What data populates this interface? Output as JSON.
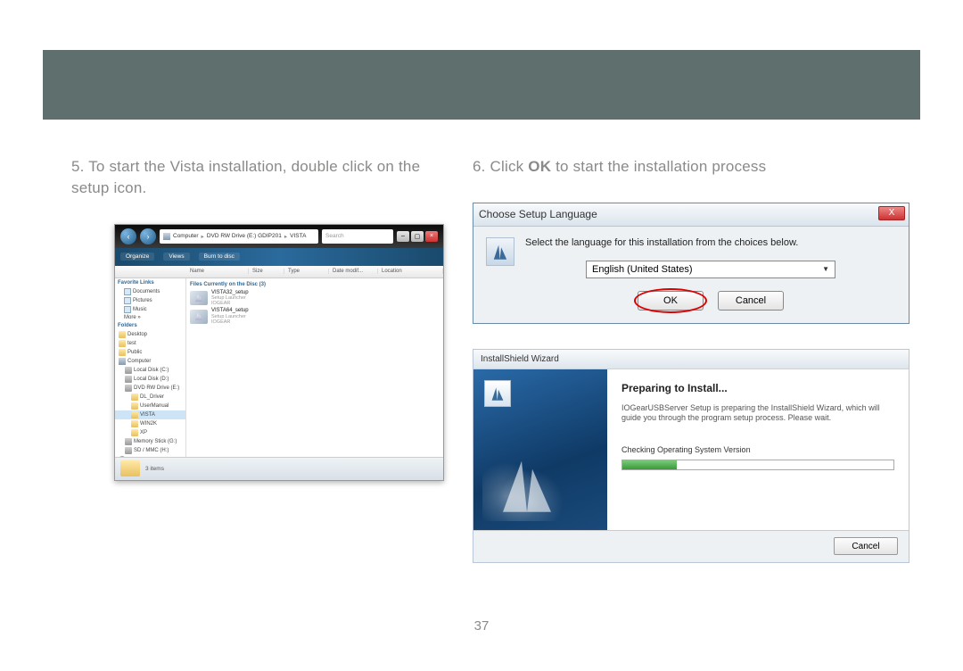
{
  "page_number": "37",
  "steps": {
    "s5_num": "5. ",
    "s5_text": "To start the Vista installation, double click on the setup icon.",
    "s6_num": "6. ",
    "s6_a": "Click ",
    "s6_ok": "OK",
    "s6_b": " to start the installation process"
  },
  "explorer": {
    "breadcrumb": [
      "Computer",
      "DVD RW Drive (E:) GDIP201",
      "VISTA"
    ],
    "search_placeholder": "Search",
    "toolbar": {
      "organize": "Organize",
      "views": "Views",
      "burn": "Burn to disc"
    },
    "columns": [
      "Name",
      "Size",
      "Type",
      "Date modif...",
      "Location"
    ],
    "sidebar": {
      "fav_header": "Favorite Links",
      "fav": [
        "Documents",
        "Pictures",
        "Music",
        "More »"
      ],
      "folders_header": "Folders",
      "tree": [
        {
          "label": "Desktop",
          "icon": "fldr"
        },
        {
          "label": "test",
          "icon": "fldr"
        },
        {
          "label": "Public",
          "icon": "fldr"
        },
        {
          "label": "Computer",
          "icon": "comp"
        },
        {
          "label": "Local Disk (C:)",
          "icon": "disk",
          "indent": 1
        },
        {
          "label": "Local Disk (D:)",
          "icon": "disk",
          "indent": 1
        },
        {
          "label": "DVD RW Drive (E:)",
          "icon": "disk",
          "indent": 1
        },
        {
          "label": "DL_Driver",
          "icon": "fldr",
          "indent": 2
        },
        {
          "label": "UserManual",
          "icon": "fldr",
          "indent": 2
        },
        {
          "label": "VISTA",
          "icon": "fldr",
          "indent": 2,
          "sel": true
        },
        {
          "label": "WIN2K",
          "icon": "fldr",
          "indent": 2
        },
        {
          "label": "XP",
          "icon": "fldr",
          "indent": 2
        },
        {
          "label": "Memory Stick (G:)",
          "icon": "disk",
          "indent": 1
        },
        {
          "label": "SD / MMC (H:)",
          "icon": "disk",
          "indent": 1
        },
        {
          "label": "Network",
          "icon": "net"
        }
      ]
    },
    "files_header": "Files Currently on the Disc (3)",
    "files": [
      {
        "name": "VISTA32_setup",
        "sub1": "Setup Launcher",
        "sub2": "IOGEAR"
      },
      {
        "name": "VISTA64_setup",
        "sub1": "Setup Launcher",
        "sub2": "IOGEAR"
      }
    ],
    "status": "3 items"
  },
  "lang_dialog": {
    "title": "Choose Setup Language",
    "message": "Select the language for this installation from the choices below.",
    "selected": "English (United States)",
    "ok": "OK",
    "cancel": "Cancel"
  },
  "wizard": {
    "title": "InstallShield Wizard",
    "heading": "Preparing to Install...",
    "body": "IOGearUSBServer Setup is preparing the InstallShield Wizard, which will guide you through the program setup process. Please wait.",
    "check": "Checking Operating System Version",
    "cancel": "Cancel"
  }
}
